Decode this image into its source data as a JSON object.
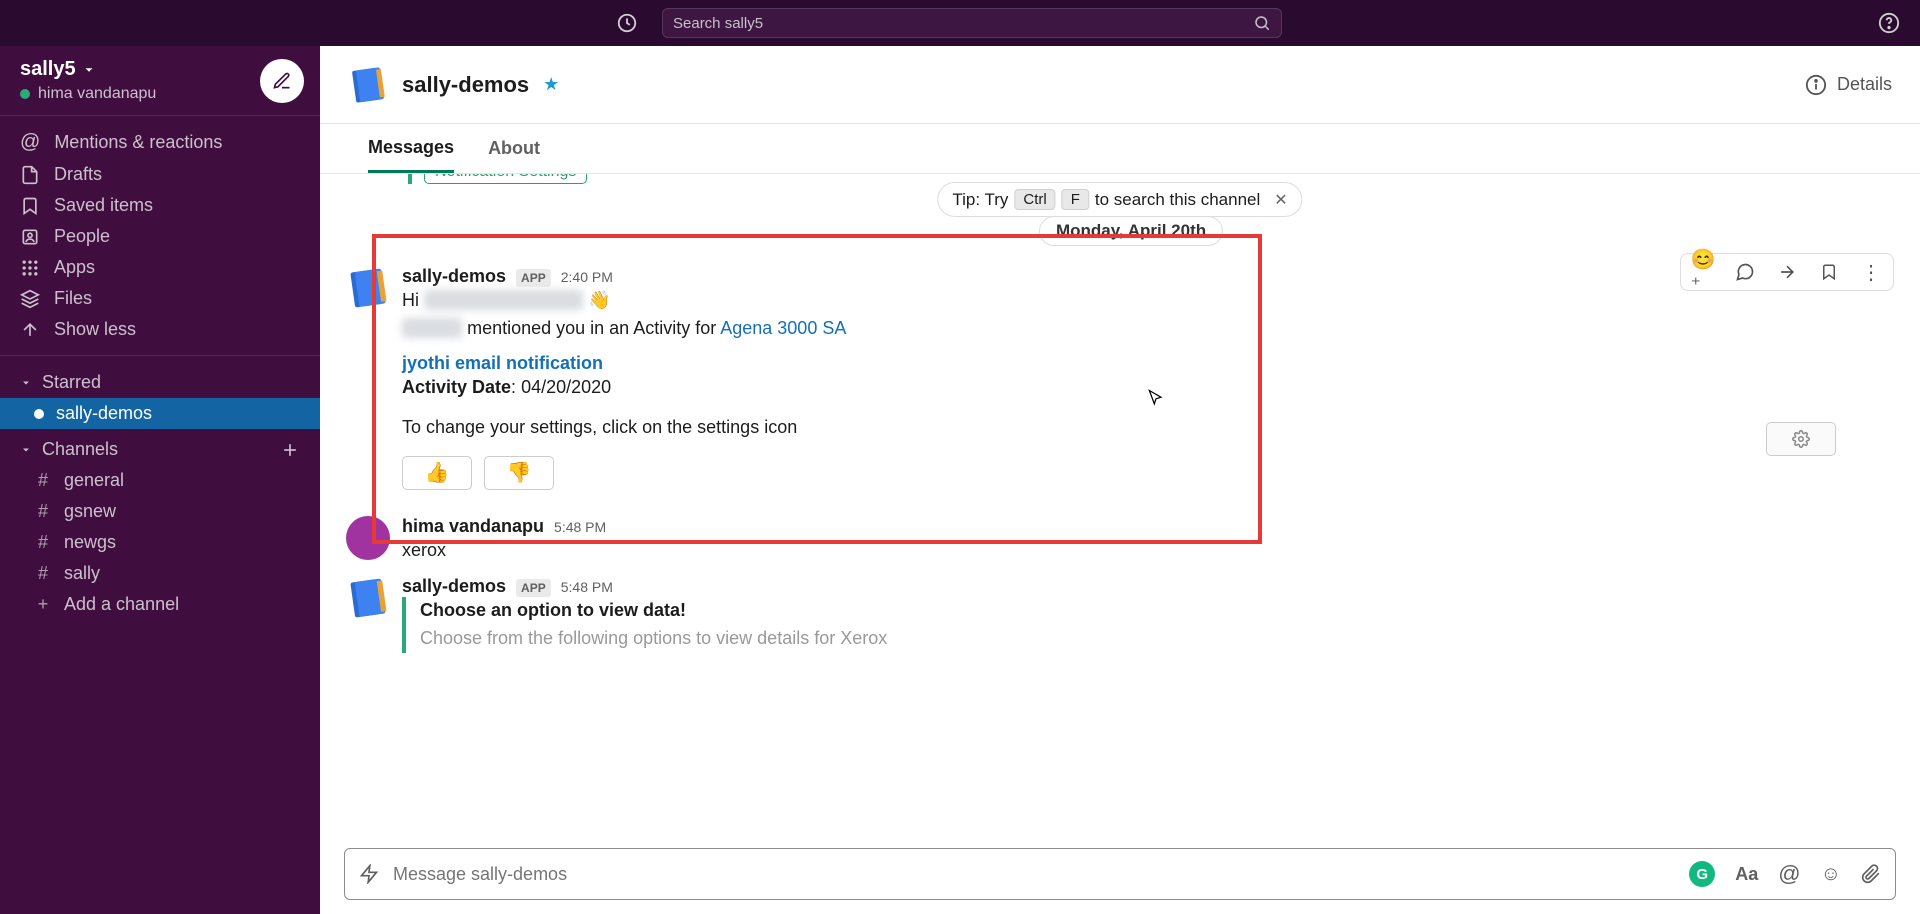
{
  "topbar": {
    "search_placeholder": "Search sally5"
  },
  "workspace": {
    "name": "sally5",
    "user": "hima vandanapu"
  },
  "nav": {
    "mentions": "Mentions & reactions",
    "drafts": "Drafts",
    "saved": "Saved items",
    "people": "People",
    "apps": "Apps",
    "files": "Files",
    "showless": "Show less"
  },
  "sections": {
    "starred": "Starred",
    "channels": "Channels",
    "add_channel": "Add a channel"
  },
  "starred_items": [
    {
      "label": "sally-demos"
    }
  ],
  "channels": [
    "general",
    "gsnew",
    "newgs",
    "sally"
  ],
  "header": {
    "title": "sally-demos",
    "details": "Details"
  },
  "tabs": {
    "messages": "Messages",
    "about": "About"
  },
  "tip": {
    "prefix": "Tip: Try",
    "key1": "Ctrl",
    "key2": "F",
    "suffix": "to search this channel"
  },
  "date_divider": "Monday, April 20th",
  "notif_settings_chip": "Notification Settings",
  "msg1": {
    "sender": "sally-demos",
    "badge": "APP",
    "time": "2:40 PM",
    "greeting_prefix": "Hi",
    "mention_blur1": "@hima vandanapu",
    "wave": "👋",
    "actor_blur": "Sadhu",
    "mentioned_text": "mentioned you in an Activity for",
    "account_link": "Agena 3000 SA",
    "activity_title": "jyothi email notification",
    "activity_date_label": "Activity Date",
    "activity_date": "04/20/2020",
    "settings_hint": "To change your settings, click on the settings icon",
    "thumbs_up": "👍",
    "thumbs_down": "👎"
  },
  "msg2": {
    "sender": "hima vandanapu",
    "time": "5:48 PM",
    "text": "xerox"
  },
  "msg3": {
    "sender": "sally-demos",
    "badge": "APP",
    "time": "5:48 PM",
    "line1": "Choose an option to view data!",
    "line2": "Choose from the following options to view details for Xerox"
  },
  "composer": {
    "placeholder": "Message sally-demos",
    "g": "G",
    "aa": "Aa"
  }
}
